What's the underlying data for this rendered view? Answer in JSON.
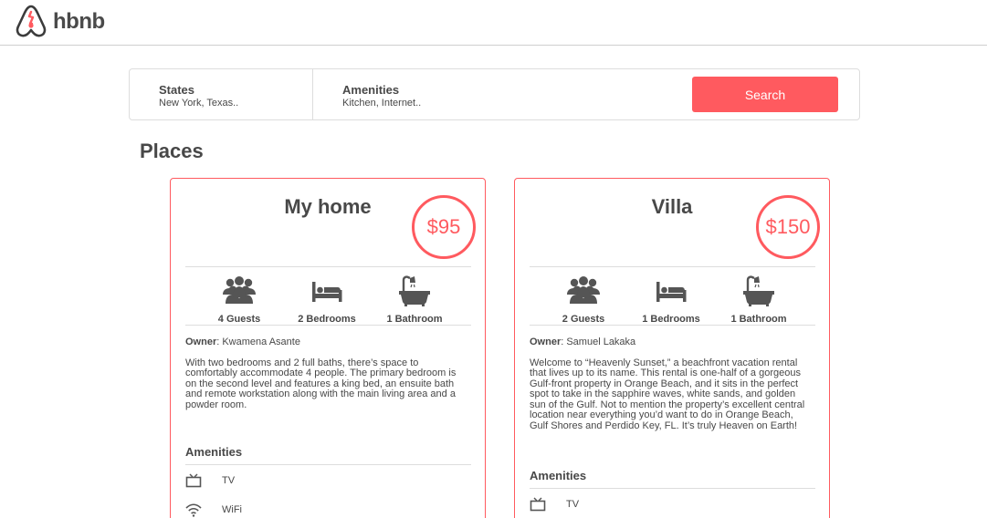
{
  "header": {
    "logo_text": "hbnb"
  },
  "filters": {
    "states": {
      "title": "States",
      "value": "New York, Texas.."
    },
    "amenities": {
      "title": "Amenities",
      "value": "Kitchen, Internet.."
    },
    "search_label": "Search"
  },
  "places_title": "Places",
  "places": [
    {
      "title": "My home",
      "price": "$95",
      "guests": "4 Guests",
      "bedrooms": "2 Bedrooms",
      "bathrooms": "1 Bathroom",
      "owner_label": "Owner",
      "owner_name": ": Kwamena Asante",
      "description": "With two bedrooms and 2 full baths, there’s space to comfortably accommodate 4 people. The primary bedroom is on the second level and features a king bed, an ensuite bath and remote workstation along with the main living area and a powder room.",
      "amenities_title": "Amenities",
      "amenities": [
        {
          "label": "TV",
          "icon": "tv-icon"
        },
        {
          "label": "WiFi",
          "icon": "wifi-icon"
        }
      ]
    },
    {
      "title": "Villa",
      "price": "$150",
      "guests": "2 Guests",
      "bedrooms": "1 Bedrooms",
      "bathrooms": "1 Bathroom",
      "owner_label": "Owner",
      "owner_name": ": Samuel Lakaka",
      "description": "Welcome to “Heavenly Sunset,” a beachfront vacation rental that lives up to its name. This rental is one-half of a gorgeous Gulf-front property in Orange Beach, and it sits in the perfect spot to take in the sapphire waves, white sands, and golden sun of the Gulf. Not to mention the property’s excellent central location near everything you’d want to do in Orange Beach, Gulf Shores and Perdido Key, FL. It’s truly Heaven on Earth!",
      "amenities_title": "Amenities",
      "amenities": [
        {
          "label": "TV",
          "icon": "tv-icon"
        }
      ]
    }
  ],
  "colors": {
    "accent": "#ff5a5f",
    "text": "#484848",
    "border": "#dddddd"
  }
}
